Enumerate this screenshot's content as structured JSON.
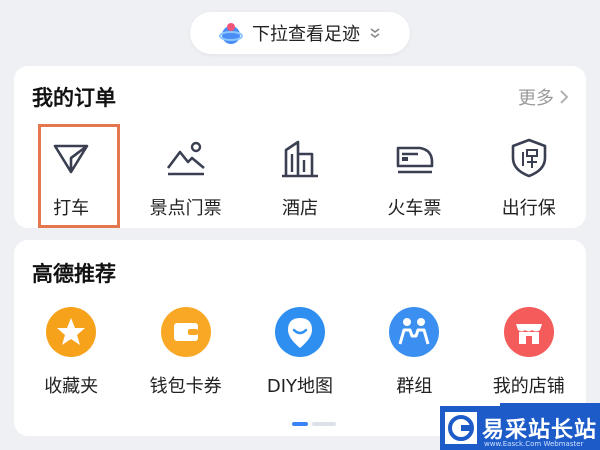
{
  "top_pill": {
    "label": "下拉查看足迹"
  },
  "orders": {
    "title": "我的订单",
    "more_label": "更多",
    "items": [
      {
        "label": "打车",
        "icon": "taxi-arrow-icon"
      },
      {
        "label": "景点门票",
        "icon": "mountain-icon"
      },
      {
        "label": "酒店",
        "icon": "building-icon"
      },
      {
        "label": "火车票",
        "icon": "train-icon"
      },
      {
        "label": "出行保",
        "icon": "shield-insurance-icon"
      }
    ]
  },
  "recommend": {
    "title": "高德推荐",
    "items": [
      {
        "label": "收藏夹",
        "icon": "star-icon",
        "color": "#f7a21b"
      },
      {
        "label": "钱包卡券",
        "icon": "wallet-icon",
        "color": "#f9a825"
      },
      {
        "label": "DIY地图",
        "icon": "map-pin-icon",
        "color": "#2f8ff0"
      },
      {
        "label": "群组",
        "icon": "group-icon",
        "color": "#3b8ff0"
      },
      {
        "label": "我的店铺",
        "icon": "store-icon",
        "color": "#f45b5b"
      }
    ]
  },
  "watermark": {
    "text": "易采站长站",
    "sub": "www.Easck.Com Webmaster"
  },
  "colors": {
    "highlight": "#e5774f",
    "accent": "#3b82f6"
  }
}
